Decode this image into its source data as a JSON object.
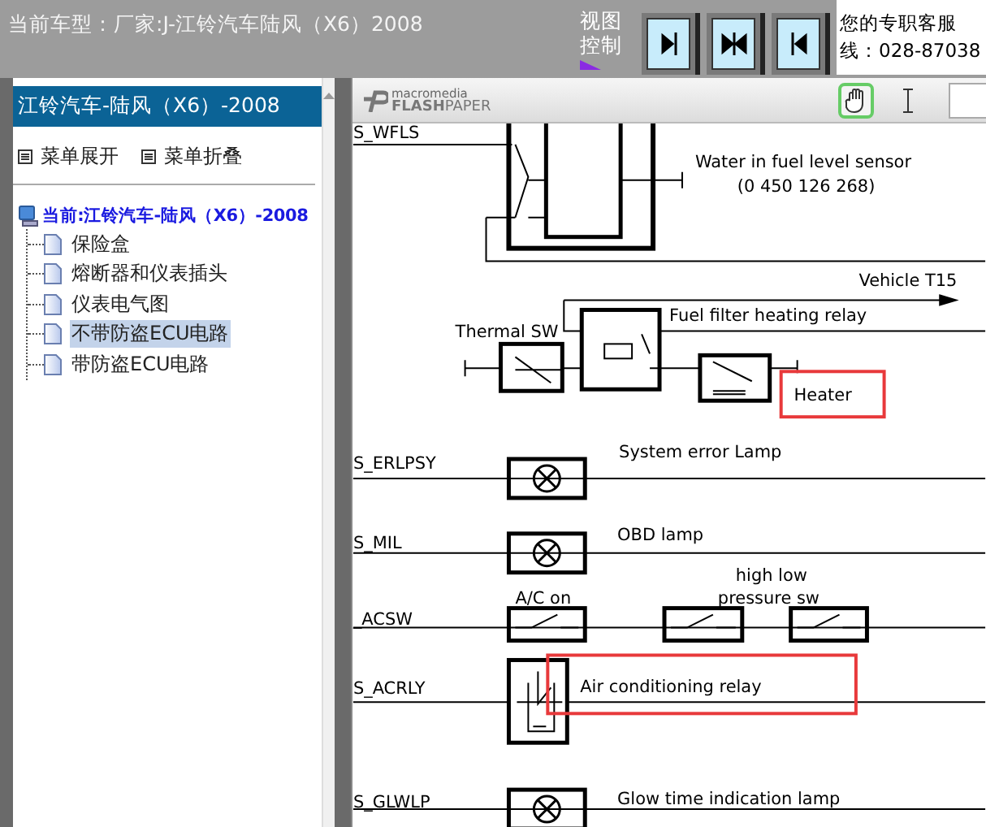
{
  "header": {
    "current_model": "当前车型：厂家:J-江铃汽车陆风（X6）2008",
    "view_control": "视图控制",
    "service_text": "您的专职客服",
    "phone": "线：028-87038"
  },
  "view_buttons": [
    {
      "kind": "right"
    },
    {
      "kind": "both"
    },
    {
      "kind": "left"
    }
  ],
  "sidebar": {
    "title": "江铃汽车-陆风（X6）-2008",
    "expand": "菜单展开",
    "collapse": "菜单折叠",
    "tree": {
      "label": "当前:江铃汽车-陆风（X6）-2008",
      "children": [
        {
          "label": "保险盒",
          "selected": false
        },
        {
          "label": "熔断器和仪表插头",
          "selected": false
        },
        {
          "label": "仪表电气图",
          "selected": false
        },
        {
          "label": "不带防盗ECU电路",
          "selected": true
        },
        {
          "label": "带防盗ECU电路",
          "selected": false
        }
      ]
    }
  },
  "viewer": {
    "logo_top": "macromedia",
    "logo_bold": "FLASH",
    "logo_rest": "PAPER",
    "tools": [
      {
        "kind": "hand",
        "selected": true
      },
      {
        "kind": "text",
        "selected": false
      }
    ]
  },
  "diagram": {
    "signals": [
      "S_WFLS",
      "S_ERLPSY",
      "S_MIL",
      "_ACSW",
      "S_ACRLY",
      "S_GLWLP"
    ],
    "labels": [
      {
        "text": "Water in fuel level sensor",
        "highlighted": false
      },
      {
        "text": "(0 450 126 268)",
        "highlighted": false
      },
      {
        "text": "Vehicle T15",
        "highlighted": false
      },
      {
        "text": "Fuel filter heating relay",
        "highlighted": false
      },
      {
        "text": "Thermal SW",
        "highlighted": false
      },
      {
        "text": "Heater",
        "highlighted": true
      },
      {
        "text": "System error Lamp",
        "highlighted": false
      },
      {
        "text": "OBD lamp",
        "highlighted": false
      },
      {
        "text": "A/C on",
        "highlighted": false
      },
      {
        "text": "high low",
        "highlighted": false
      },
      {
        "text": "pressure sw",
        "highlighted": false
      },
      {
        "text": "Air conditioning relay",
        "highlighted": true
      },
      {
        "text": "Glow time indication lamp",
        "highlighted": false
      }
    ]
  }
}
